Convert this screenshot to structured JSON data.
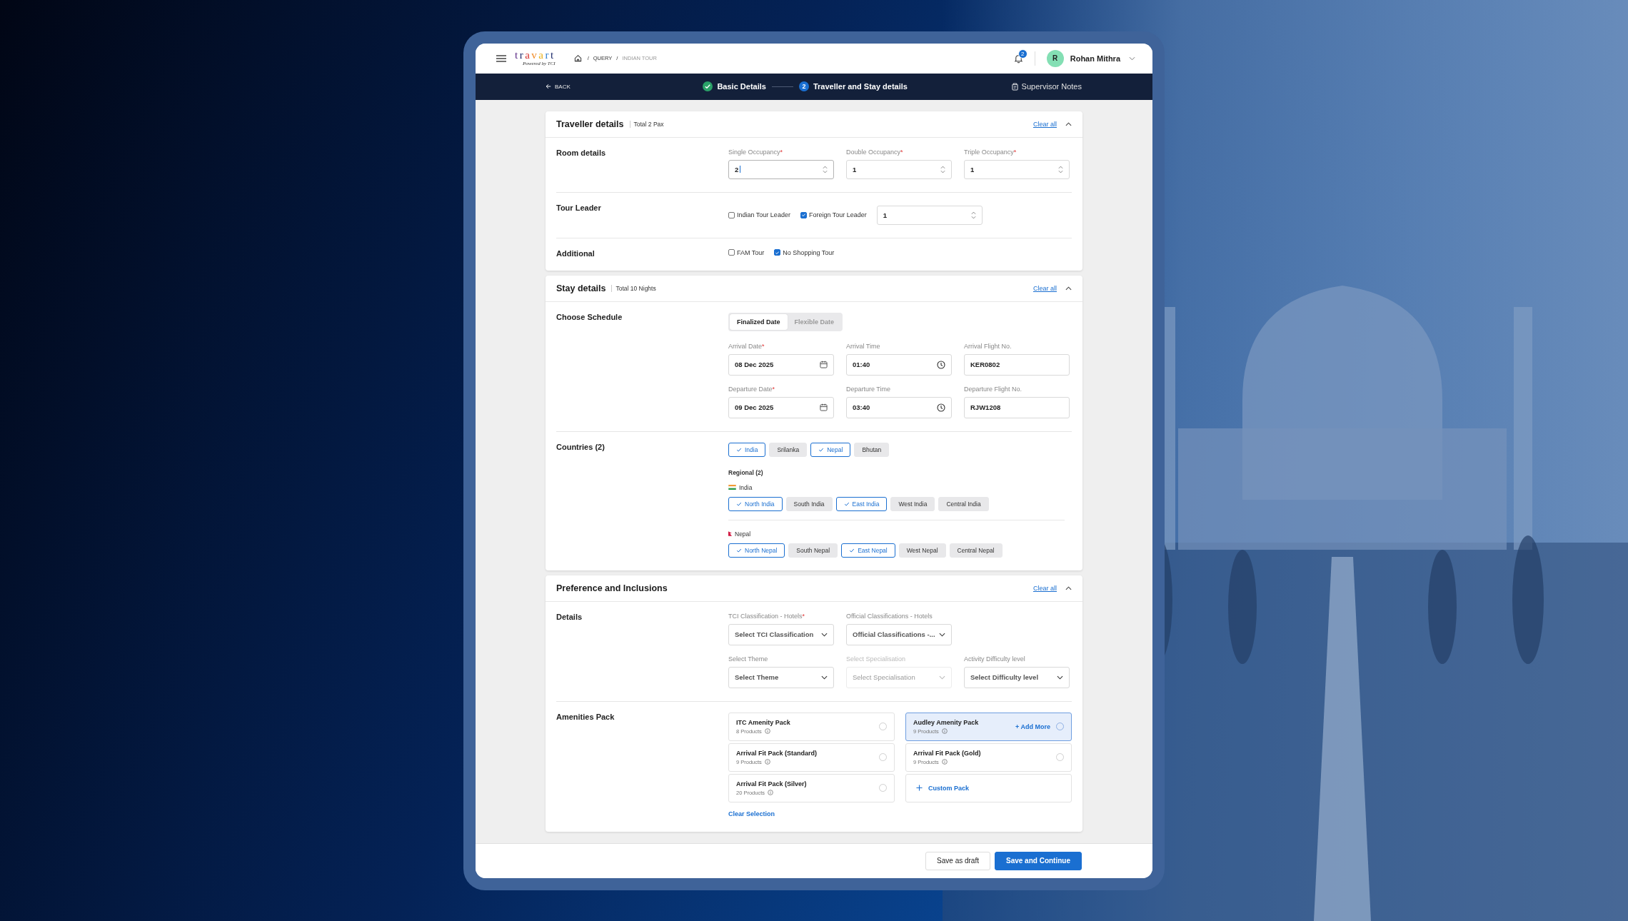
{
  "header": {
    "brand": "travart",
    "brand_tagline": "Powered by TCI",
    "breadcrumbs": [
      {
        "separator": "/",
        "label": "QUERY",
        "current": false
      },
      {
        "separator": "/",
        "label": "INDIAN TOUR",
        "current": true
      }
    ],
    "notification_count": "2",
    "user": {
      "initial": "R",
      "name": "Rohan Mithra"
    }
  },
  "stepper": {
    "back": "BACK",
    "steps": [
      {
        "label": "Basic Details",
        "completed": true
      },
      {
        "label": "Traveller and Stay details",
        "number": "2",
        "completed": false
      }
    ],
    "notes": "Supervisor Notes"
  },
  "sections": [
    {
      "title": "Traveller details",
      "summary": "Total 2 Pax",
      "clear": "Clear all",
      "expanded": true,
      "rows": [
        {
          "kind": "numbers",
          "label": "Room details",
          "fields": [
            {
              "label": "Single Occupancy",
              "required_mark": "*",
              "value": "2",
              "focused": true
            },
            {
              "label": "Double Occupancy",
              "required_mark": "*",
              "value": "1",
              "focused": false
            },
            {
              "label": "Triple Occupancy",
              "required_mark": "*",
              "value": "1",
              "focused": false
            }
          ]
        },
        {
          "kind": "checks",
          "label": "Tour Leader",
          "checks": [
            {
              "label": "Indian Tour Leader",
              "checked": false
            },
            {
              "label": "Foreign Tour Leader",
              "checked": true
            }
          ],
          "count": {
            "value": "1"
          }
        },
        {
          "kind": "checks",
          "label": "Additional",
          "checks": [
            {
              "label": "FAM Tour",
              "checked": false
            },
            {
              "label": "No Shopping Tour",
              "checked": true
            }
          ]
        }
      ]
    },
    {
      "title": "Stay details",
      "summary": "Total 10 Nights",
      "clear": "Clear all",
      "expanded": true,
      "rows": [
        {
          "kind": "schedule",
          "label": "Choose Schedule",
          "options": [
            {
              "label": "Finalized Date",
              "selected": true
            },
            {
              "label": "Flexible Date",
              "selected": false
            }
          ],
          "fields": [
            {
              "label": "Arrival Date",
              "required_mark": "*",
              "value": "08 Dec 2025",
              "kind": "date"
            },
            {
              "label": "Arrival Time",
              "value": "01:40",
              "kind": "time"
            },
            {
              "label": "Arrival Flight No.",
              "value": "KER0802",
              "kind": "text"
            },
            {
              "label": "Departure Date",
              "required_mark": "*",
              "value": "09 Dec 2025",
              "kind": "date"
            },
            {
              "label": "Departure Time",
              "value": "03:40",
              "kind": "time"
            },
            {
              "label": "Departure Flight No.",
              "value": "RJW1208",
              "kind": "text"
            }
          ]
        },
        {
          "kind": "countries",
          "label": "Countries (2)",
          "chips": [
            {
              "label": "India",
              "selected": true
            },
            {
              "label": "Srilanka",
              "selected": false
            },
            {
              "label": "Nepal",
              "selected": true
            },
            {
              "label": "Bhutan",
              "selected": false
            }
          ],
          "regional_title": "Regional (2)",
          "regions": [
            {
              "country": "India",
              "chips": [
                {
                  "label": "North India",
                  "selected": true
                },
                {
                  "label": "South India",
                  "selected": false
                },
                {
                  "label": "East India",
                  "selected": true
                },
                {
                  "label": "West India",
                  "selected": false
                },
                {
                  "label": "Central India",
                  "selected": false
                }
              ]
            },
            {
              "country": "Nepal",
              "chips": [
                {
                  "label": "North Nepal",
                  "selected": true
                },
                {
                  "label": "South Nepal",
                  "selected": false
                },
                {
                  "label": "East Nepal",
                  "selected": true
                },
                {
                  "label": "West Nepal",
                  "selected": false
                },
                {
                  "label": "Central Nepal",
                  "selected": false
                }
              ]
            }
          ]
        }
      ]
    },
    {
      "title": "Preference and Inclusions",
      "clear": "Clear all",
      "expanded": true,
      "rows": [
        {
          "kind": "selects",
          "label": "Details",
          "select_rows": [
            [
              {
                "label": "TCI Classification - Hotels",
                "required_mark": "*",
                "placeholder": "Select TCI Classification",
                "disabled": false
              },
              {
                "label": "Official Classifications - Hotels",
                "placeholder": "Official Classifications -...",
                "disabled": false
              }
            ],
            [
              {
                "label": "Select Theme",
                "placeholder": "Select Theme",
                "disabled": false
              },
              {
                "label": "Select Specialisation",
                "placeholder": "Select Specialisation",
                "disabled": true
              },
              {
                "label": "Activity Difficulty level",
                "placeholder": "Select  Difficulty level",
                "disabled": false
              }
            ]
          ]
        },
        {
          "kind": "amenities",
          "label": "Amenities Pack",
          "packs": [
            {
              "kind": "pack",
              "name": "ITC Amenity Pack",
              "count": "8 Products",
              "selected": false
            },
            {
              "kind": "pack",
              "name": "Audley Amenity Pack",
              "count": "9 Products",
              "selected": true,
              "action": "+ Add More"
            },
            {
              "kind": "pack",
              "name": "Arrival Fit Pack (Standard)",
              "count": "9 Products",
              "selected": false
            },
            {
              "kind": "pack",
              "name": "Arrival Fit Pack (Gold)",
              "count": "9 Products",
              "selected": false
            },
            {
              "kind": "pack",
              "name": "Arrival Fit Pack (Silver)",
              "count": "20 Products",
              "selected": false
            },
            {
              "kind": "custom",
              "name": "Custom Pack"
            }
          ],
          "clear": "Clear Selection"
        }
      ]
    }
  ],
  "footer": {
    "buttons": [
      {
        "label": "Save as draft",
        "kind": "secondary"
      },
      {
        "label": "Save and Continue",
        "kind": "primary"
      }
    ]
  }
}
